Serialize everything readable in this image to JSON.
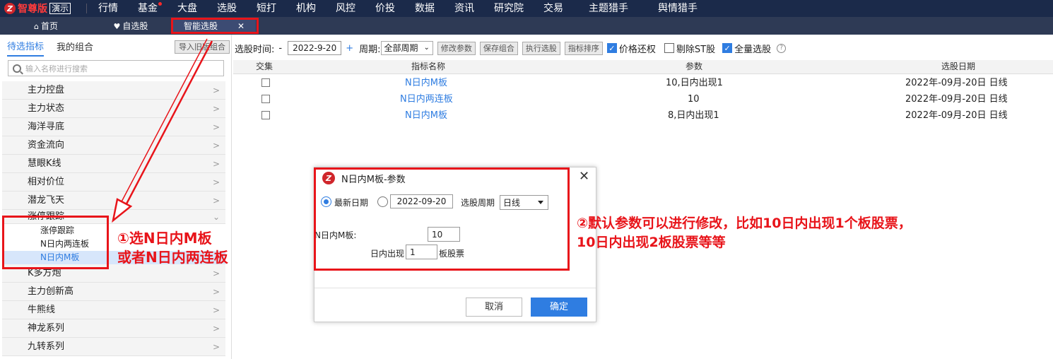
{
  "app": {
    "logo_text": "智尊版",
    "logo_badge": "演示",
    "nav": [
      "行情",
      "基金",
      "大盘",
      "选股",
      "短打",
      "机构",
      "风控",
      "价投",
      "数据",
      "资讯",
      "研究院",
      "交易",
      "主题猎手",
      "舆情猎手"
    ]
  },
  "tabs": {
    "home": "首页",
    "watchlist": "自选股",
    "smart": "智能选股",
    "close_glyph": "✕"
  },
  "left": {
    "tab_indicators": "待选指标",
    "tab_portfolio": "我的组合",
    "import_btn": "导入旧版组合",
    "search_placeholder": "输入名称进行搜索",
    "categories_top": [
      "主力控盘",
      "主力状态",
      "海洋寻底",
      "资金流向",
      "慧眼K线",
      "相对价位",
      "潜龙飞天"
    ],
    "expanded": "涨停跟踪",
    "sub_items": [
      "涨停跟踪",
      "N日内两连板",
      "N日内M板"
    ],
    "categories_bottom": [
      "K多方炮",
      "主力创新高",
      "牛熊线",
      "神龙系列",
      "九转系列"
    ]
  },
  "toolbar": {
    "time_label": "选股时间:",
    "minus": "-",
    "date": "2022-9-20",
    "plus": "+",
    "period_label": "周期:",
    "period_value": "全部周期",
    "btn_modify": "修改参数",
    "btn_save": "保存组合",
    "btn_run": "执行选股",
    "btn_sort": "指标排序",
    "cb_price": "价格还权",
    "cb_st": "剔除ST股",
    "cb_all": "全量选股",
    "help": "?"
  },
  "grid": {
    "headers": [
      "交集",
      "指标名称",
      "参数",
      "选股日期"
    ],
    "rows": [
      {
        "name": "N日内M板",
        "param": "10,日内出现1",
        "date": "2022年-09月-20日 日线"
      },
      {
        "name": "N日内两连板",
        "param": "10",
        "date": "2022年-09月-20日 日线"
      },
      {
        "name": "N日内M板",
        "param": "8,日内出现1",
        "date": "2022年-09月-20日 日线"
      }
    ]
  },
  "dialog": {
    "title": "N日内M板-参数",
    "close": "✕",
    "latest_date": "最新日期",
    "date_value": "2022-09-20",
    "period_label": "选股周期",
    "period_value": "日线",
    "n_label": "N日内M板:",
    "n_value": "10",
    "within_label": "日内出现",
    "within_value": "1",
    "suffix": "板股票",
    "cancel": "取消",
    "ok": "确定"
  },
  "annotations": {
    "a1_line1": "①选N日内M板",
    "a1_line2": "或者N日内两连板",
    "a2_line1": "②默认参数可以进行修改，比如10日内出现1个板股票，",
    "a2_line2": "10日内出现2板股票等等"
  },
  "colors": {
    "nav_bg": "#1b2a4a",
    "accent": "#2f7de1",
    "annotation": "#e8141a"
  }
}
